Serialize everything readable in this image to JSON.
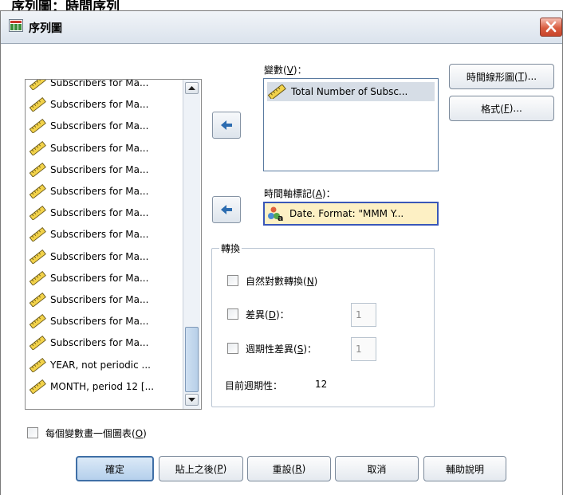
{
  "background_title": "序列圖：時間序列",
  "window": {
    "title": "序列圖"
  },
  "variables": [
    "Subscribers for Ma...",
    "Subscribers for Ma...",
    "Subscribers for Ma...",
    "Subscribers for Ma...",
    "Subscribers for Ma...",
    "Subscribers for Ma...",
    "Subscribers for Ma...",
    "Subscribers for Ma...",
    "Subscribers for Ma...",
    "Subscribers for Ma...",
    "Subscribers for Ma...",
    "Subscribers for Ma...",
    "Subscribers for Ma...",
    "YEAR, not periodic ...",
    "MONTH, period 12 [..."
  ],
  "variables_field": {
    "label_prefix": "變數(",
    "label_key": "V",
    "label_suffix": ")：",
    "selected_item": "Total Number of Subsc..."
  },
  "time_axis": {
    "label_prefix": "時間軸標記(",
    "label_key": "A",
    "label_suffix": ")：",
    "value": "Date.  Format:  \"MMM Y..."
  },
  "side_buttons": {
    "time_lines": {
      "prefix": "時間線形圖(",
      "key": "T",
      "suffix": ")..."
    },
    "format": {
      "prefix": "格式(",
      "key": "F",
      "suffix": ")..."
    }
  },
  "transform": {
    "legend": "轉換",
    "natural_log": {
      "prefix": "自然對數轉換(",
      "key": "N",
      "suffix": ")"
    },
    "difference": {
      "prefix": "差異(",
      "key": "D",
      "suffix": ")：",
      "value": "1"
    },
    "seasonal_difference": {
      "prefix": "週期性差異(",
      "key": "S",
      "suffix": ")：",
      "value": "1"
    },
    "periodicity_label": "目前週期性：",
    "periodicity_value": "12"
  },
  "one_chart_per_variable": {
    "prefix": "每個變數畫一個圖表(",
    "key": "O",
    "suffix": ")"
  },
  "buttons": {
    "ok": "確定",
    "paste": {
      "prefix": "貼上之後(",
      "key": "P",
      "suffix": ")"
    },
    "reset": {
      "prefix": "重設(",
      "key": "R",
      "suffix": ")"
    },
    "cancel": "取消",
    "help": "輔助說明"
  },
  "colors": {
    "time_box_fill": "#fdf0c4",
    "time_box_border": "#3a57b8",
    "close_button": "#d95d40"
  }
}
